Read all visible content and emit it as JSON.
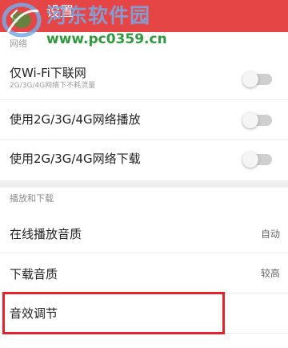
{
  "header": {
    "title": "设置",
    "back_icon": "back-arrow-icon",
    "background_color": "#e54545"
  },
  "watermark": {
    "name": "河东软件园",
    "url": "www.pc0359.cn",
    "logo_icon": "watermark-logo-icon"
  },
  "network_section": {
    "label": "网络"
  },
  "settings": {
    "wifi_only": {
      "title": "仅Wi-Fi下联网",
      "subtitle": "2G/3G/4G网络下不耗流量",
      "enabled": false
    },
    "mobile_play": {
      "title": "使用2G/3G/4G网络播放",
      "enabled": false
    },
    "mobile_download": {
      "title": "使用2G/3G/4G网络下载",
      "enabled": false
    }
  },
  "playback_section": {
    "label": "播放和下载",
    "online_quality": {
      "title": "在线播放音质",
      "value": "自动"
    },
    "download_quality": {
      "title": "下载音质",
      "value": "较高"
    },
    "sound_effects": {
      "title": "音效调节"
    }
  },
  "colors": {
    "accent": "#e54545",
    "highlight_border": "#e3222b",
    "toggle_off": "#cfcfcf"
  }
}
